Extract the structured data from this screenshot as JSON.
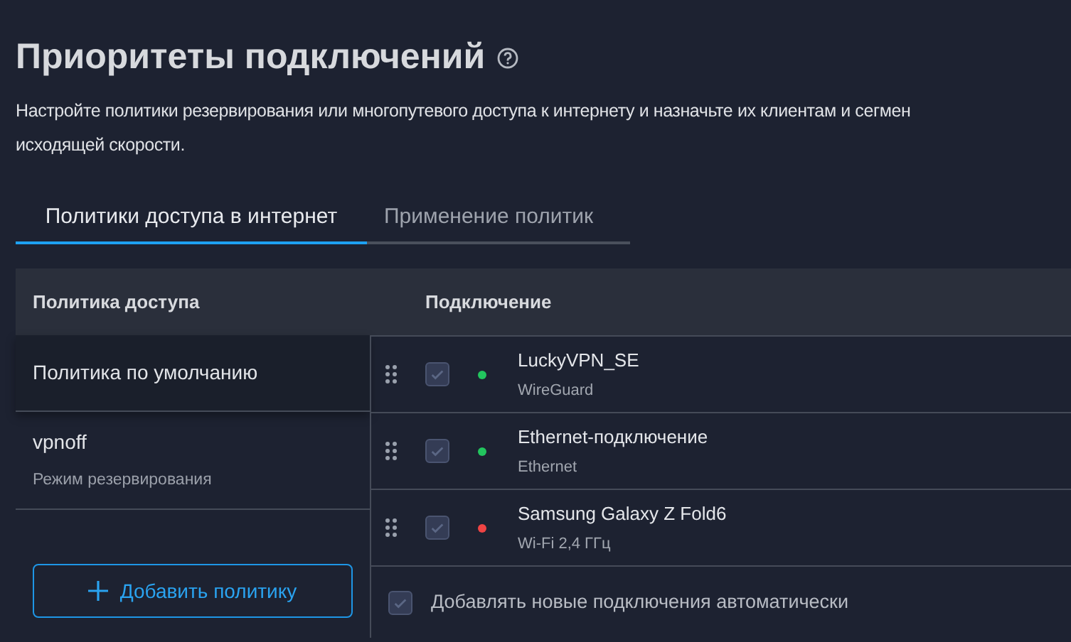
{
  "title": "Приоритеты подключений",
  "description": [
    "Настройте политики резервирования или многопутевого доступа к интернету и назначьте их клиентам и сегмен",
    "исходящей скорости."
  ],
  "tabs": [
    {
      "label": "Политики доступа в интернет",
      "selected": true
    },
    {
      "label": "Применение политик",
      "selected": false
    }
  ],
  "table": {
    "columns": [
      "Политика доступа",
      "Подключение"
    ],
    "policies": [
      {
        "name": "Политика по умолчанию"
      },
      {
        "name": "vpnoff",
        "mode": "Режим резервирования"
      }
    ],
    "add_button": "Добавить политику",
    "connections": [
      {
        "name": "LuckyVPN_SE",
        "type": "WireGuard",
        "checked": true,
        "color": "#22c55e"
      },
      {
        "name": "Ethernet-подключение",
        "type": "Ethernet",
        "checked": true,
        "color": "#22c55e"
      },
      {
        "name": "Samsung Galaxy Z Fold6",
        "type": "Wi-Fi 2,4 ГГц",
        "checked": true,
        "color": "#ef4444"
      }
    ],
    "auto_add": {
      "label": "Добавлять новые подключения автоматически",
      "checked": true
    }
  }
}
